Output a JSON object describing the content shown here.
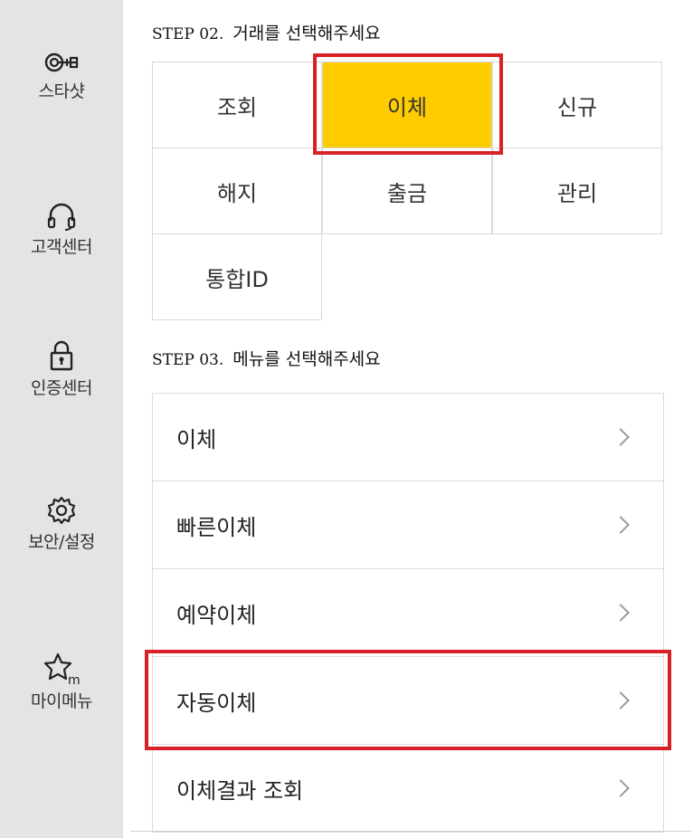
{
  "sidebar": {
    "items": [
      {
        "label": "스타샷",
        "icon": "star-shot-icon"
      },
      {
        "label": "고객센터",
        "icon": "headset-icon"
      },
      {
        "label": "인증센터",
        "icon": "lock-icon"
      },
      {
        "label": "보안/설정",
        "icon": "gear-icon"
      },
      {
        "label": "마이메뉴",
        "icon": "star-m-icon"
      }
    ]
  },
  "step2": {
    "prefix": "STEP 02.",
    "title": "거래를 선택해주세요",
    "options": [
      "조회",
      "이체",
      "신규",
      "해지",
      "출금",
      "관리",
      "통합ID"
    ],
    "selected": "이체"
  },
  "step3": {
    "prefix": "STEP 03.",
    "title": "메뉴를 선택해주세요",
    "items": [
      "이체",
      "빠른이체",
      "예약이체",
      "자동이체",
      "이체결과 조회"
    ]
  },
  "colors": {
    "active": "#ffcc00",
    "highlight": "#d92027",
    "sidebar_bg": "#e4e4e4"
  }
}
